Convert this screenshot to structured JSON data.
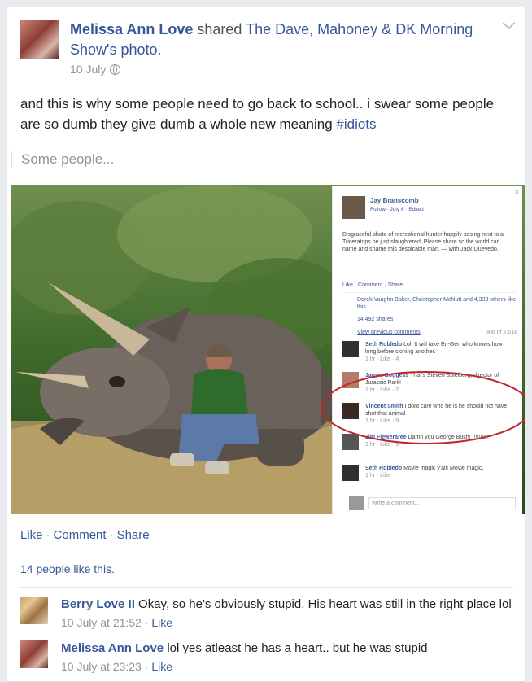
{
  "post": {
    "author": "Melissa Ann Love",
    "verb": " shared ",
    "page": "The Dave, Mahoney & DK Morning Show",
    "suffix": "'s photo.",
    "date": "10 July",
    "message": "and this is why some people need to go back to school.. i swear some people are so dumb they give dumb a whole new meaning ",
    "hashtag": "#idiots",
    "quote": "Some people..."
  },
  "screenshot": {
    "poster": "Jay Branscomb",
    "follow": "Follow · July 6 · Edited",
    "caption": "Disgraceful photo of recreational hunter happily posing next to a Triceratops he just slaughtered. Please share so the world can name and shame this despicable man. — with Jack Quevedo.",
    "actions": "Like · Comment · Share",
    "likes": "Derek Vaughn Baker, Christopher McNutt and 4,333 others like this.",
    "shares": "14,492 shares",
    "view_prev": "View previous comments",
    "count": "306 of 2,618",
    "comments": [
      {
        "name": "Seth Robledo",
        "text": "Lol. It will take En-Gen who knows how long before cloning another.",
        "meta": "1 hr · Like · 4"
      },
      {
        "name": "James Boggess",
        "text": "That's Steven Spielberg, director of Jurassic Park!",
        "meta": "1 hr · Like · 2"
      },
      {
        "name": "Vincent Smith",
        "text": "I dont care who he is he should not have shot that animal",
        "meta": "1 hr · Like · 9"
      },
      {
        "name": "Jim Fleweraree",
        "text": "Damn you George Bush! !!!!!!!!!!",
        "meta": "1 hr · Like · 5"
      },
      {
        "name": "Seth Robledo",
        "text": "Movie magic y'all! Movie magic.",
        "meta": "1 hr · Like"
      }
    ],
    "write": "Write a comment..."
  },
  "actions": {
    "like": "Like",
    "comment": "Comment",
    "share": "Share"
  },
  "likes_line": "14 people like this.",
  "comments": [
    {
      "author": "Berry Love II",
      "text": "Okay, so he's obviously stupid. His heart was still in the right place lol",
      "time": "10 July at 21:52",
      "like": "Like"
    },
    {
      "author": "Melissa Ann Love",
      "text": "lol yes atleast he has a heart.. but he was stupid",
      "time": "10 July at 23:23",
      "like": "Like"
    }
  ],
  "colors": {
    "link": "#365899",
    "text": "#1d2129",
    "meta": "#90949c",
    "circle": "#c0262b"
  }
}
